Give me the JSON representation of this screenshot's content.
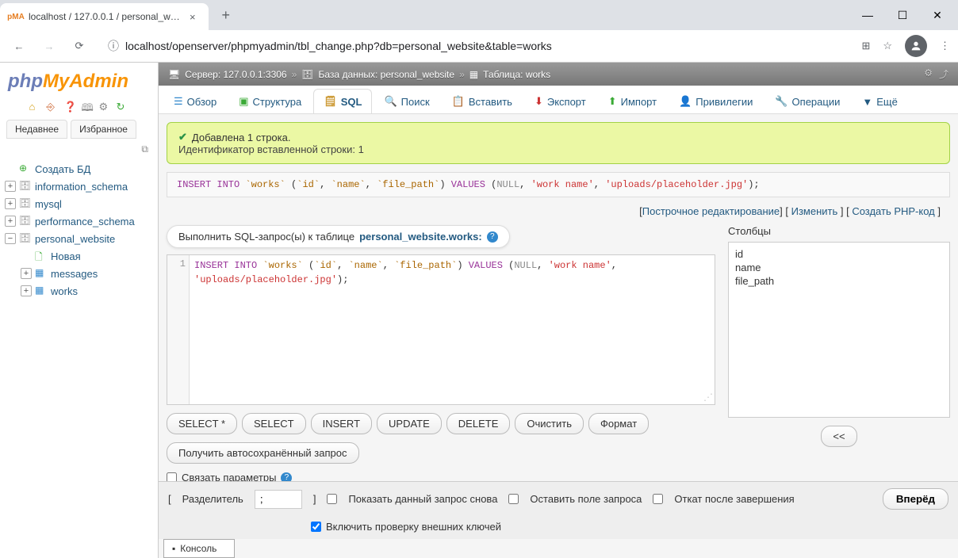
{
  "browser": {
    "tab_title": "localhost / 127.0.0.1 / personal_w…",
    "url": "localhost/openserver/phpmyadmin/tbl_change.php?db=personal_website&table=works"
  },
  "sidebar": {
    "nav_recent": "Недавнее",
    "nav_favorites": "Избранное",
    "create_db": "Создать БД",
    "databases": [
      "information_schema",
      "mysql",
      "performance_schema",
      "personal_website"
    ],
    "new_label": "Новая",
    "tables": [
      "messages",
      "works"
    ]
  },
  "breadcrumb": {
    "server_label": "Сервер:",
    "server_value": "127.0.0.1:3306",
    "db_label": "База данных:",
    "db_value": "personal_website",
    "table_label": "Таблица:",
    "table_value": "works"
  },
  "tabs": {
    "browse": "Обзор",
    "structure": "Структура",
    "sql": "SQL",
    "search": "Поиск",
    "insert": "Вставить",
    "export": "Экспорт",
    "import": "Импорт",
    "privileges": "Привилегии",
    "operations": "Операции",
    "more": "Ещё"
  },
  "success": {
    "msg": "Добавлена 1 строка.",
    "id_msg": "Идентификатор вставленной строки: 1"
  },
  "links": {
    "inline_edit": "Построчное редактирование",
    "edit": "Изменить",
    "create_php": "Создать PHP-код"
  },
  "sql_form": {
    "header_prefix": "Выполнить SQL-запрос(ы) к таблице",
    "header_table": "personal_website.works:",
    "btn_select_star": "SELECT *",
    "btn_select": "SELECT",
    "btn_insert": "INSERT",
    "btn_update": "UPDATE",
    "btn_delete": "DELETE",
    "btn_clear": "Очистить",
    "btn_format": "Формат",
    "btn_autosave": "Получить автосохранённый запрос",
    "bind_params": "Связать параметры",
    "columns_label": "Столбцы",
    "columns": [
      "id",
      "name",
      "file_path"
    ],
    "insert_col_btn": "<<"
  },
  "footer": {
    "delimiter_label": "Разделитель",
    "delimiter_value": ";",
    "show_again": "Показать данный запрос снова",
    "keep_query": "Оставить поле запроса",
    "rollback": "Откат после завершения",
    "fk_check": "Включить проверку внешних ключей",
    "submit": "Вперёд"
  },
  "console_label": "Консоль"
}
